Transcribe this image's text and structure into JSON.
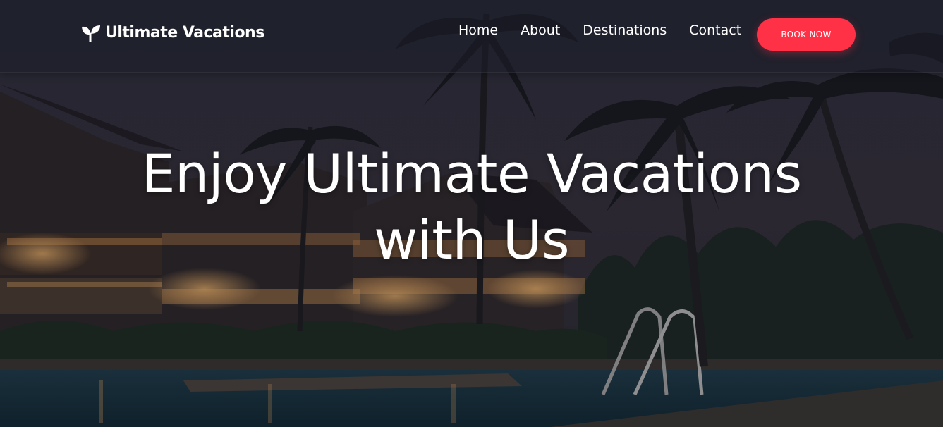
{
  "brand": {
    "name": "Ultimate Vacations",
    "icon": "sprout-icon"
  },
  "nav": {
    "items": [
      {
        "label": "Home"
      },
      {
        "label": "About"
      },
      {
        "label": "Destinations"
      },
      {
        "label": "Contact"
      }
    ],
    "cta_label": "BOOK NOW"
  },
  "hero": {
    "title_line1": "Enjoy Ultimate Vacations",
    "title_line2": "with Us",
    "background": "night-resort-pool-with-palm-trees"
  },
  "colors": {
    "accent": "#ff3147",
    "text": "#ffffff",
    "navbar_overlay": "rgba(28,30,40,0.55)"
  }
}
